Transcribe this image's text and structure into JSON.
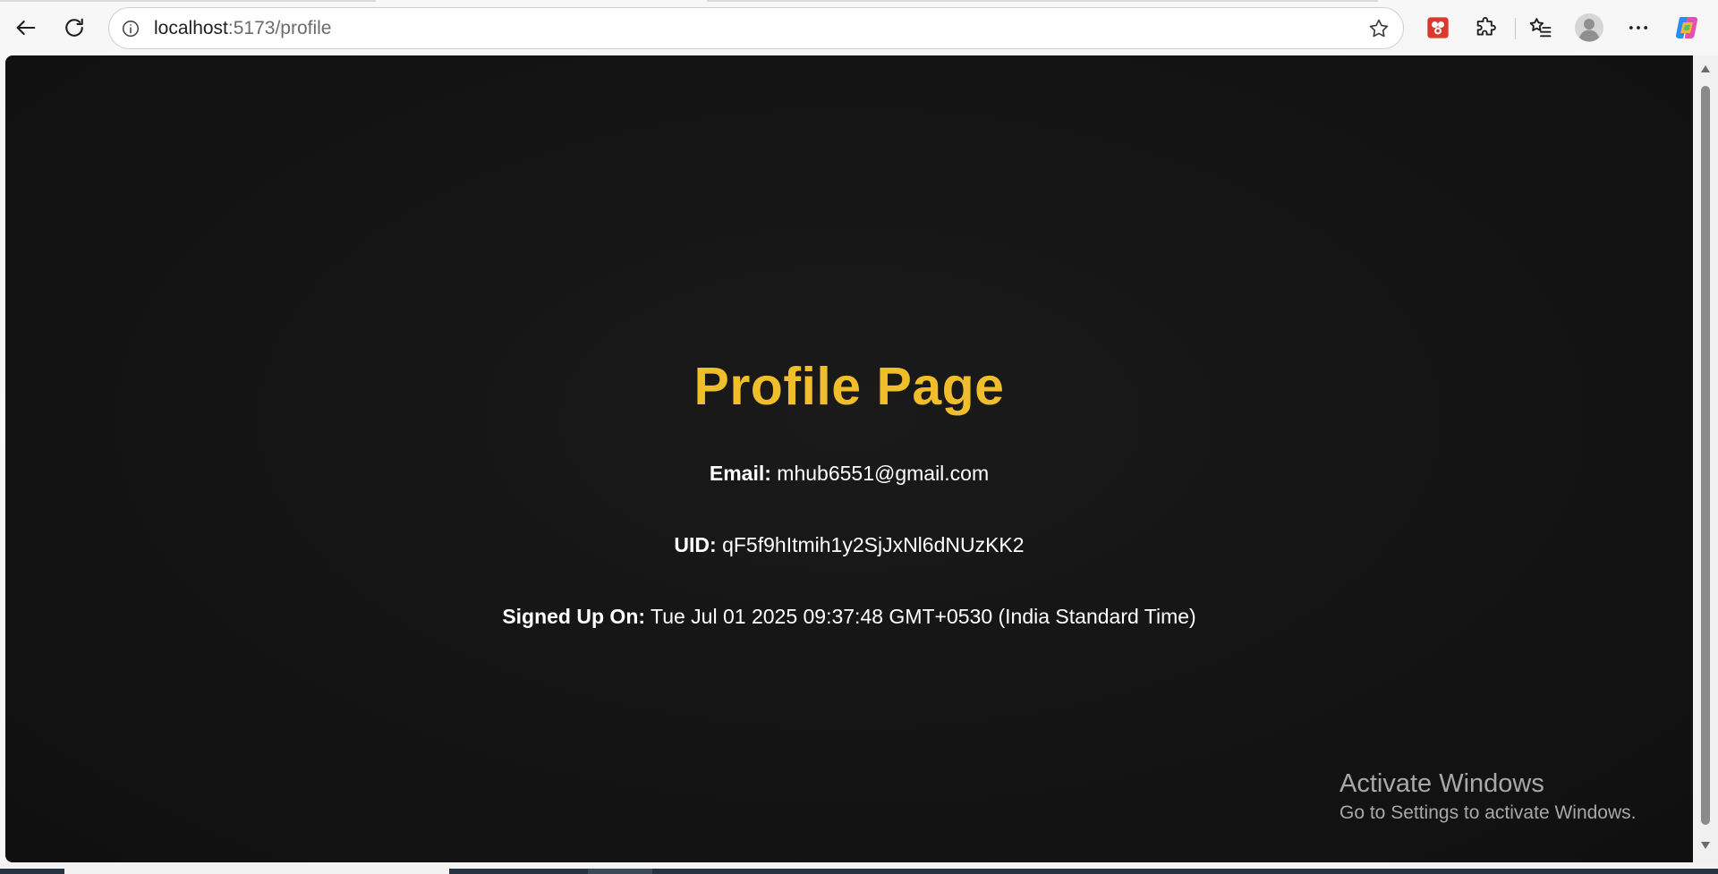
{
  "browser": {
    "url_host": "localhost",
    "url_rest": ":5173/profile",
    "icons": {
      "back": "back-arrow-icon",
      "reload": "reload-icon",
      "site_info": "info-icon",
      "favorite": "star-icon",
      "extension_red": "extension-red-icon",
      "extensions": "puzzle-icon",
      "favorites": "favorites-list-icon",
      "profile": "avatar-icon",
      "more": "more-dots-icon",
      "copilot": "copilot-icon"
    }
  },
  "page": {
    "title": "Profile Page",
    "email_label": "Email:",
    "email_value": "mhub6551@gmail.com",
    "uid_label": "UID:",
    "uid_value": "qF5f9hItmih1y2SjJxNl6dNUzKK2",
    "signed_label": "Signed Up On:",
    "signed_value": "Tue Jul 01 2025 09:37:48 GMT+0530 (India Standard Time)"
  },
  "watermark": {
    "title": "Activate Windows",
    "subtitle": "Go to Settings to activate Windows."
  },
  "colors": {
    "title_accent": "#f0bd2b",
    "page_background": "#131313",
    "text": "#ffffff"
  }
}
